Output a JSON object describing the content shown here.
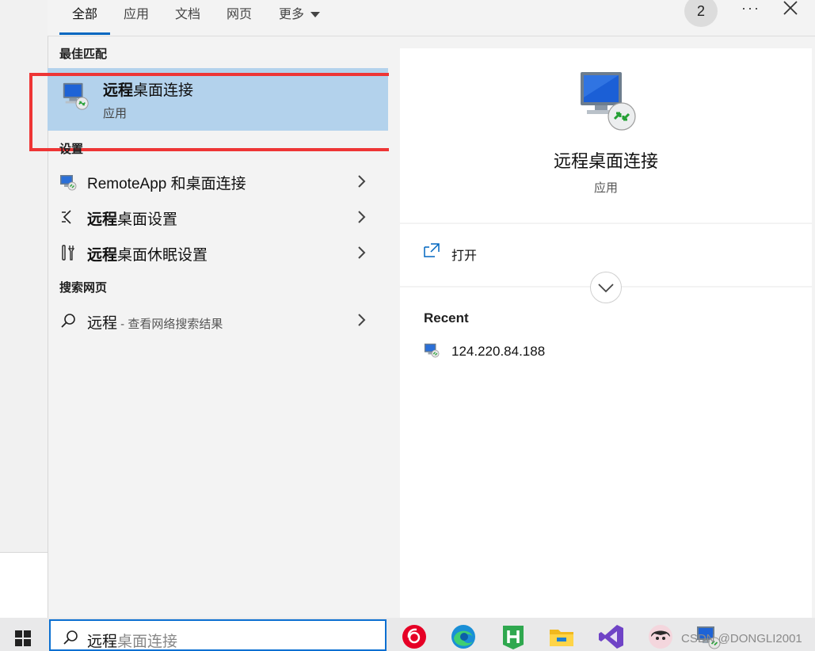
{
  "tabs": {
    "all": "全部",
    "apps": "应用",
    "docs": "文档",
    "web": "网页",
    "more": "更多"
  },
  "counter": "2",
  "more_options_icon": "ellipsis-icon",
  "close_icon": "close-icon",
  "best_match": {
    "section_label": "最佳匹配",
    "title_bold": "远程",
    "title_rest": "桌面连接",
    "subtitle": "应用"
  },
  "settings": {
    "section_label": "设置",
    "items": [
      {
        "label_bold": "",
        "label_rest": "RemoteApp 和桌面连接",
        "icon": "remoteapp-icon"
      },
      {
        "label_bold": "远程",
        "label_rest": "桌面设置",
        "icon": "remote-arrows-icon"
      },
      {
        "label_bold": "远程",
        "label_rest": "桌面休眠设置",
        "icon": "wrench-screwdriver-icon"
      }
    ]
  },
  "web_search": {
    "section_label": "搜索网页",
    "query": "远程",
    "hint": " - 查看网络搜索结果"
  },
  "detail": {
    "title": "远程桌面连接",
    "subtitle": "应用",
    "open_label": "打开",
    "recent_heading": "Recent",
    "recent_items": [
      "124.220.84.188"
    ]
  },
  "taskbar": {
    "search_typed": "远程",
    "search_suggest": "桌面连接",
    "apps": [
      "netease-music-icon",
      "edge-icon",
      "hbuilder-icon",
      "file-explorer-icon",
      "visual-studio-icon",
      "avatar-app-icon",
      "remote-desktop-taskbar-icon"
    ]
  },
  "watermark": "CSDN @DONGLI2001",
  "colors": {
    "accent": "#0067c0",
    "selection": "#b3d2ec",
    "highlight_box": "#ee3535"
  }
}
